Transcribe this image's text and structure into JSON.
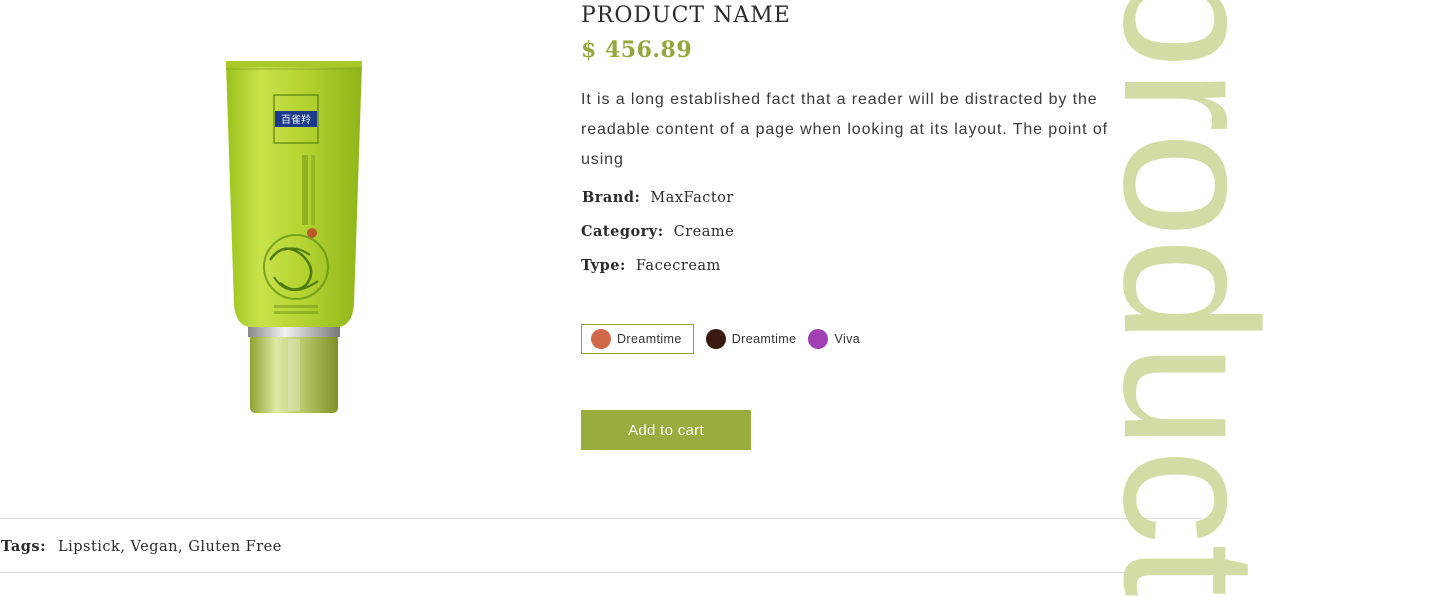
{
  "product": {
    "name": "PRODUCT NAME",
    "price": "$ 456.89",
    "description": "It is a long established fact that a reader will be distracted by the readable content of a page when looking at its layout. The point of using",
    "image_icon": "product-tube-image"
  },
  "meta": {
    "brand_label": "Brand:",
    "brand_value": "MaxFactor",
    "category_label": "Category:",
    "category_value": "Creame",
    "type_label": "Type:",
    "type_value": "Facecream"
  },
  "swatches": [
    {
      "label": "Dreamtime",
      "color": "#d0694a",
      "selected": true
    },
    {
      "label": "Dreamtime",
      "color": "#3a1a10",
      "selected": false
    },
    {
      "label": "Viva",
      "color": "#a13fb4",
      "selected": false
    }
  ],
  "cart": {
    "button_label": "Add to cart"
  },
  "tags": {
    "label": "Tags:",
    "value": "Lipstick, Vegan, Gluten Free"
  },
  "watermark": {
    "text": "product"
  },
  "colors": {
    "accent": "#98ad3d",
    "price": "#93a83b",
    "watermark": "#d4dca5",
    "selected_border": "#8fa33a"
  }
}
